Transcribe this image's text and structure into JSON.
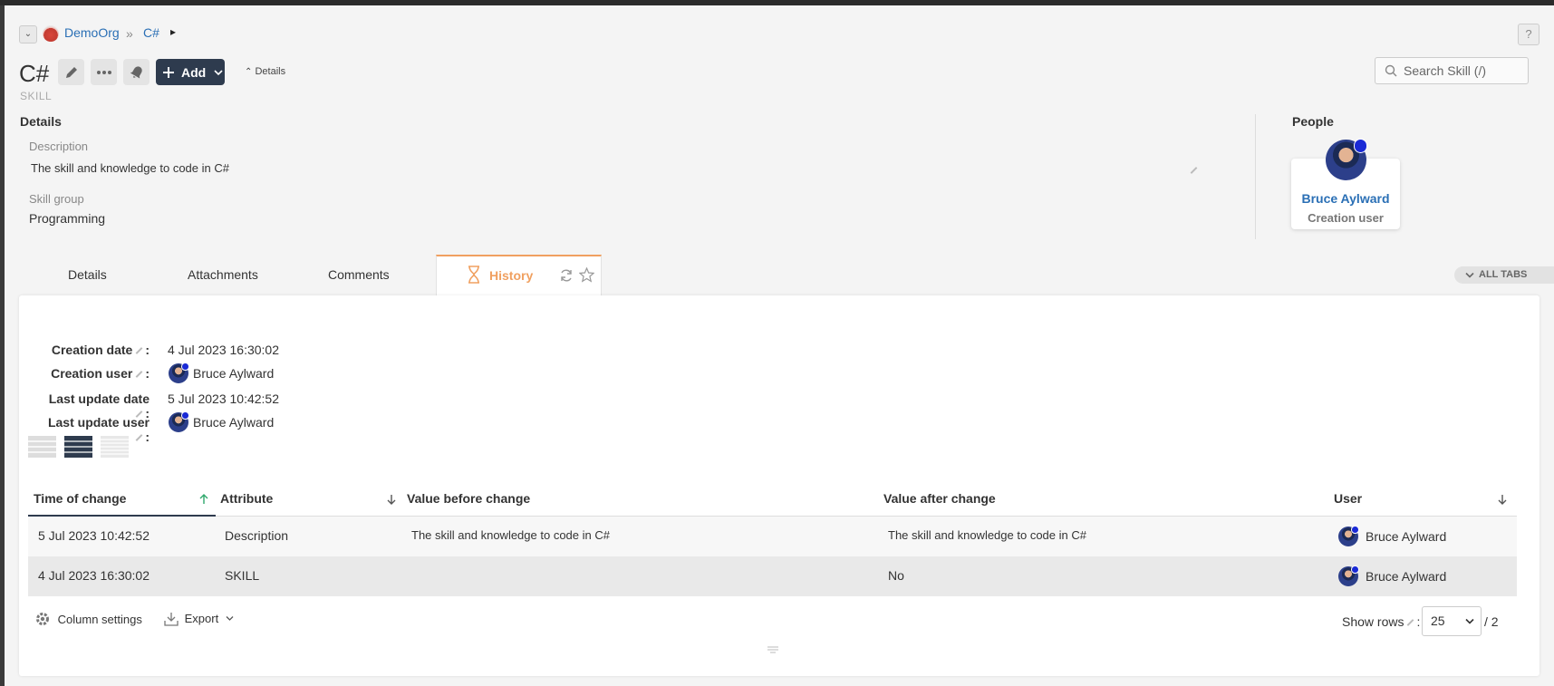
{
  "breadcrumb": {
    "org": "DemoOrg",
    "separator": "»",
    "current": "C#",
    "caret": "▸"
  },
  "help_label": "?",
  "header": {
    "title": "C#",
    "type_label": "SKILL",
    "add_label": "Add",
    "details_toggle": "Details",
    "search_placeholder": "Search Skill (/)"
  },
  "details": {
    "heading": "Details",
    "description_label": "Description",
    "description_value": "The skill and knowledge to code in C#",
    "skill_group_label": "Skill group",
    "skill_group_value": "Programming"
  },
  "people": {
    "heading": "People",
    "name": "Bruce Aylward",
    "role": "Creation user"
  },
  "tabs": [
    {
      "label": "Details"
    },
    {
      "label": "Attachments"
    },
    {
      "label": "Comments"
    },
    {
      "label": "History",
      "active": true
    }
  ],
  "all_tabs_label": "ALL TABS",
  "history": {
    "meta": [
      {
        "label": "Creation date",
        "value": "4 Jul 2023 16:30:02"
      },
      {
        "label": "Creation user",
        "value": "Bruce Aylward"
      },
      {
        "label": "Last update date",
        "value": "5 Jul 2023 10:42:52"
      },
      {
        "label": "Last update user",
        "value": "Bruce Aylward"
      }
    ],
    "columns": [
      "Time of change",
      "Attribute",
      "Value before change",
      "Value after change",
      "User"
    ],
    "rows": [
      {
        "time": "5 Jul 2023 10:42:52",
        "attribute": "Description",
        "before": "The skill and knowledge to code in C#",
        "after": "The skill and knowledge to code in C#",
        "user": "Bruce Aylward"
      },
      {
        "time": "4 Jul 2023 16:30:02",
        "attribute": "SKILL",
        "before": "",
        "after": "No",
        "user": "Bruce Aylward"
      }
    ],
    "footer": {
      "column_settings": "Column settings",
      "export": "Export",
      "show_rows": "Show rows",
      "rows_value": "25",
      "total": "/ 2"
    }
  },
  "colors": {
    "accent_dark": "#2e3b4e",
    "link": "#2a6fb5",
    "active_tab": "#f0a060"
  }
}
